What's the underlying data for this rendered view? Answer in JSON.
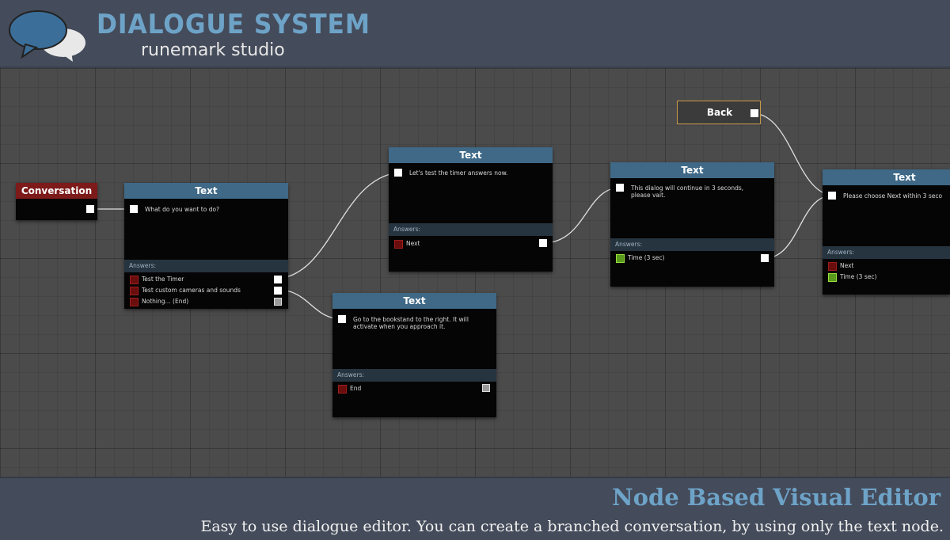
{
  "header": {
    "title": "DIALOGUE SYSTEM",
    "subtitle": "runemark studio",
    "logo_icon": "speech-bubbles-icon"
  },
  "colors": {
    "accent": "#6ea3c8",
    "text_node_header": "#3f6987",
    "conversation_header": "#7d1a1a",
    "back_border": "#c89a4a",
    "answer_red": "#6a0d0d",
    "answer_green": "#5a9a1c"
  },
  "nodes": {
    "conversation": {
      "title": "Conversation"
    },
    "text1": {
      "title": "Text",
      "body": "What do you want to do?",
      "answers_label": "Answers:",
      "answers": [
        "Test the Timer",
        "Test custom cameras and sounds",
        "Nothing... (End)"
      ]
    },
    "text2": {
      "title": "Text",
      "body": "Let's test the timer answers now.",
      "answers_label": "Answers:",
      "answers": [
        "Next"
      ]
    },
    "text3": {
      "title": "Text",
      "body": "Go to the bookstand to the right. It will activate when you approach it.",
      "answers_label": "Answers:",
      "answers": [
        "End"
      ]
    },
    "text4": {
      "title": "Text",
      "body": "This dialog will continue in 3 seconds, please vait.",
      "answers_label": "Answers:",
      "answers": [
        "Time (3 sec)"
      ]
    },
    "text5": {
      "title": "Text",
      "body": "Please choose Next within 3 seco",
      "answers_label": "Answers:",
      "answers": [
        "Next",
        "Time (3 sec)"
      ]
    },
    "back": {
      "title": "Back"
    }
  },
  "footer": {
    "title": "Node Based Visual Editor",
    "description": "Easy to use dialogue editor. You can create a branched conversation, by using only the text node."
  }
}
